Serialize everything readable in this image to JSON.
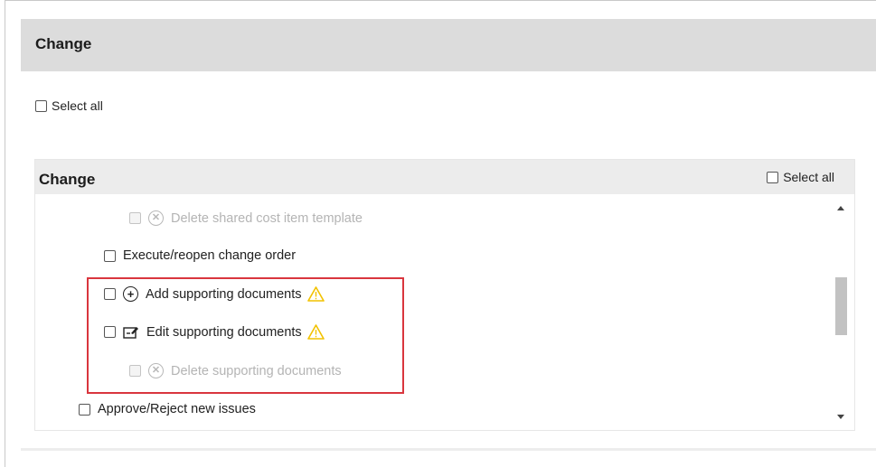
{
  "outer": {
    "title": "Change",
    "select_all_label": "Select all"
  },
  "inner": {
    "title": "Change",
    "select_all_label": "Select all"
  },
  "permissions": [
    {
      "label": "Delete shared cost item template",
      "icon": "delete-icon",
      "disabled": true,
      "warning": false
    },
    {
      "label": "Execute/reopen change order",
      "icon": "",
      "disabled": false,
      "warning": false
    },
    {
      "label": "Add supporting documents",
      "icon": "add-icon",
      "disabled": false,
      "warning": true
    },
    {
      "label": "Edit supporting documents",
      "icon": "edit-icon",
      "disabled": false,
      "warning": true
    },
    {
      "label": "Delete supporting documents",
      "icon": "delete-icon",
      "disabled": true,
      "warning": false
    },
    {
      "label": "Approve/Reject new issues",
      "icon": "",
      "disabled": false,
      "warning": false
    }
  ],
  "colors": {
    "highlight": "#d9363e",
    "warning": "#f2c200",
    "header": "#dcdcdc"
  }
}
